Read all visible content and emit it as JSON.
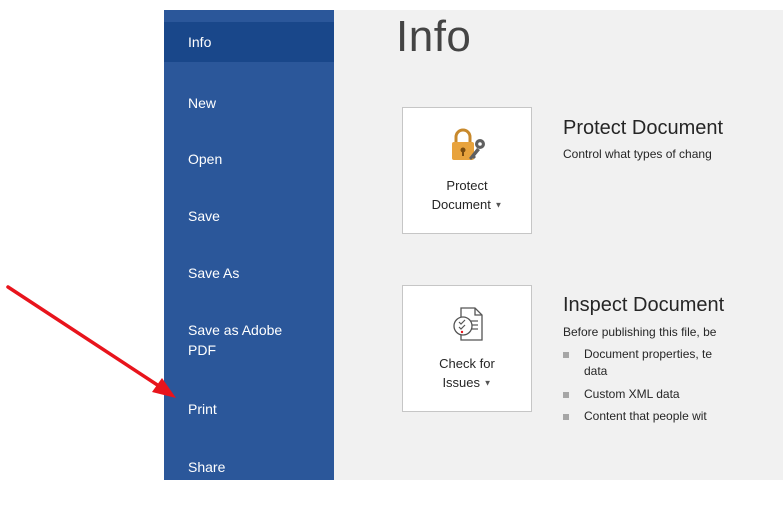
{
  "sidebar": {
    "items": [
      {
        "label": "Info"
      },
      {
        "label": "New"
      },
      {
        "label": "Open"
      },
      {
        "label": "Save"
      },
      {
        "label": "Save As"
      },
      {
        "label": "Save as Adobe PDF"
      },
      {
        "label": "Print"
      },
      {
        "label": "Share"
      }
    ]
  },
  "main": {
    "title": "Info",
    "protect": {
      "button_line1": "Protect",
      "button_line2": "Document",
      "title": "Protect Document",
      "description": "Control what types of chang"
    },
    "inspect": {
      "button_line1": "Check for",
      "button_line2": "Issues",
      "title": "Inspect Document",
      "description": "Before publishing this file, be",
      "bullets": [
        {
          "line1": "Document properties, te",
          "line2": "data"
        },
        {
          "line1": "Custom XML data"
        },
        {
          "line1": "Content that people wit"
        }
      ]
    }
  },
  "colors": {
    "sidebar_bg": "#2b579a",
    "sidebar_active": "#19478a",
    "main_bg": "#f1f1f1",
    "arrow": "#e8141c",
    "lock": "#e8a33d"
  }
}
